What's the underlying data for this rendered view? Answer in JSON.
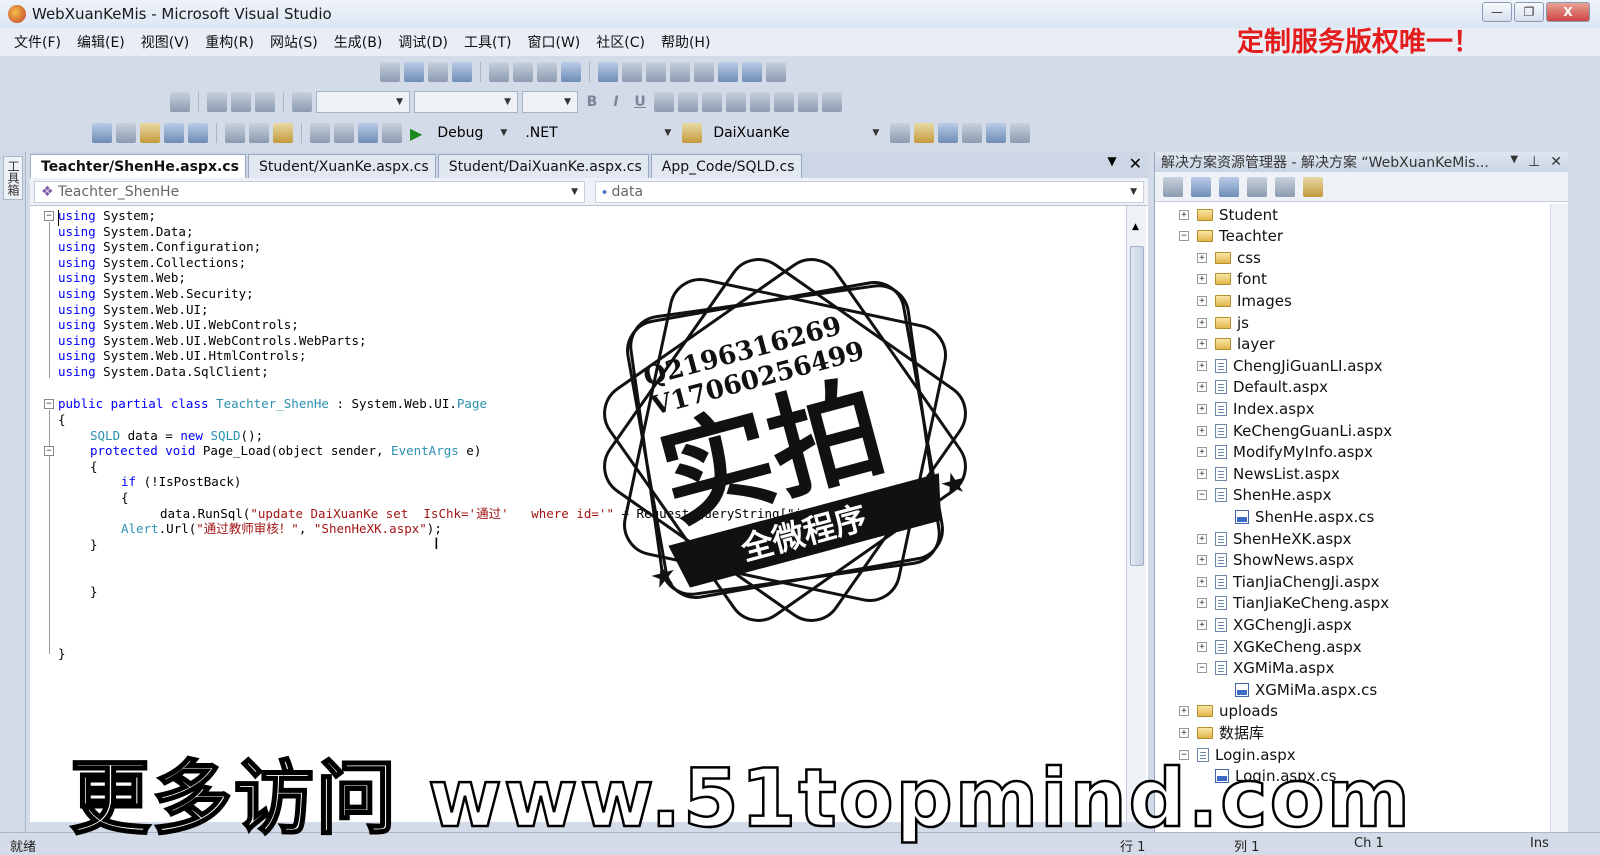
{
  "window": {
    "title": "WebXuanKeMis - Microsoft Visual Studio",
    "btn_min": "—",
    "btn_max": "❐",
    "btn_close": "X"
  },
  "promo_banner": "定制服务版权唯一！",
  "menu": [
    "文件(F)",
    "编辑(E)",
    "视图(V)",
    "重构(R)",
    "网站(S)",
    "生成(B)",
    "调试(D)",
    "工具(T)",
    "窗口(W)",
    "社区(C)",
    "帮助(H)"
  ],
  "toolbar": {
    "config": "Debug",
    "platform": ".NET",
    "find_target": "DaiXuanKe",
    "fmt_bold": "B",
    "fmt_italic": "I",
    "fmt_underline": "U"
  },
  "toolbox_label": "工具箱",
  "tabs": [
    {
      "label": "Teachter/ShenHe.aspx.cs",
      "active": true
    },
    {
      "label": "Student/XuanKe.aspx.cs",
      "active": false
    },
    {
      "label": "Student/DaiXuanKe.aspx.cs",
      "active": false
    },
    {
      "label": "App_Code/SQLD.cs",
      "active": false
    }
  ],
  "navbar": {
    "type_combo": "Teachter_ShenHe",
    "member_combo": "data"
  },
  "code": {
    "using_lines": [
      "using System;",
      "using System.Data;",
      "using System.Configuration;",
      "using System.Collections;",
      "using System.Web;",
      "using System.Web.Security;",
      "using System.Web.UI;",
      "using System.Web.UI.WebControls;",
      "using System.Web.UI.WebControls.WebParts;",
      "using System.Web.UI.HtmlControls;",
      "using System.Data.SqlClient;"
    ],
    "class_decl_kw": "public partial class ",
    "class_name": "Teachter_ShenHe",
    "class_colon": " : System.Web.UI.",
    "class_base": "Page",
    "open_brace": "{",
    "field_type": "SQLD",
    "field_mid": " data = ",
    "field_new": "new ",
    "field_type2": "SQLD",
    "field_end": "();",
    "method_kw": "protected void ",
    "method_sig": "Page_Load(object sender, ",
    "method_arg_type": "EventArgs",
    "method_end": " e)",
    "if_kw": "if ",
    "if_cond": "(!IsPostBack)",
    "runsql_pre": "data.RunSql(",
    "runsql_str": "\"update DaiXuanKe set  IsChk='通过'   where id='\"",
    "runsql_post": " + Request.QueryString[\"id\"].ToString());",
    "alert_cls": "Alert",
    "alert_pre": ".Url(",
    "alert_str1": "\"通过教师审核！\"",
    "alert_mid": ", ",
    "alert_str2": "\"ShenHeXK.aspx\"",
    "alert_end": ");",
    "close_brace": "}"
  },
  "solution_explorer": {
    "title": "解决方案资源管理器 - 解决方案 “WebXuanKeMis...",
    "items": [
      {
        "label": "Student",
        "type": "folder",
        "level": 0,
        "expander": "+"
      },
      {
        "label": "Teachter",
        "type": "folder",
        "level": 0,
        "expander": "−"
      },
      {
        "label": "css",
        "type": "folder",
        "level": 1,
        "expander": "+"
      },
      {
        "label": "font",
        "type": "folder",
        "level": 1,
        "expander": "+"
      },
      {
        "label": "Images",
        "type": "folder",
        "level": 1,
        "expander": "+"
      },
      {
        "label": "js",
        "type": "folder",
        "level": 1,
        "expander": "+"
      },
      {
        "label": "layer",
        "type": "folder",
        "level": 1,
        "expander": "+"
      },
      {
        "label": "ChengJiGuanLI.aspx",
        "type": "file",
        "level": 1,
        "expander": "+"
      },
      {
        "label": "Default.aspx",
        "type": "file",
        "level": 1,
        "expander": "+"
      },
      {
        "label": "Index.aspx",
        "type": "file",
        "level": 1,
        "expander": "+"
      },
      {
        "label": "KeChengGuanLi.aspx",
        "type": "file",
        "level": 1,
        "expander": "+"
      },
      {
        "label": "ModifyMyInfo.aspx",
        "type": "file",
        "level": 1,
        "expander": "+"
      },
      {
        "label": "NewsList.aspx",
        "type": "file",
        "level": 1,
        "expander": "+"
      },
      {
        "label": "ShenHe.aspx",
        "type": "file",
        "level": 1,
        "expander": "−"
      },
      {
        "label": "ShenHe.aspx.cs",
        "type": "cs",
        "level": 2,
        "expander": ""
      },
      {
        "label": "ShenHeXK.aspx",
        "type": "file",
        "level": 1,
        "expander": "+"
      },
      {
        "label": "ShowNews.aspx",
        "type": "file",
        "level": 1,
        "expander": "+"
      },
      {
        "label": "TianJiaChengJi.aspx",
        "type": "file",
        "level": 1,
        "expander": "+"
      },
      {
        "label": "TianJiaKeCheng.aspx",
        "type": "file",
        "level": 1,
        "expander": "+"
      },
      {
        "label": "XGChengJi.aspx",
        "type": "file",
        "level": 1,
        "expander": "+"
      },
      {
        "label": "XGKeCheng.aspx",
        "type": "file",
        "level": 1,
        "expander": "+"
      },
      {
        "label": "XGMiMa.aspx",
        "type": "file",
        "level": 1,
        "expander": "−"
      },
      {
        "label": "XGMiMa.aspx.cs",
        "type": "cs",
        "level": 2,
        "expander": ""
      },
      {
        "label": "uploads",
        "type": "folder",
        "level": 0,
        "expander": "+"
      },
      {
        "label": "数据库",
        "type": "folder",
        "level": 0,
        "expander": "+"
      },
      {
        "label": "Login.aspx",
        "type": "file",
        "level": 0,
        "expander": "−"
      },
      {
        "label": "Login.aspx.cs",
        "type": "cs",
        "level": 1,
        "expander": ""
      }
    ]
  },
  "status": {
    "left": "就绪",
    "line": "行 1",
    "col": "列 1",
    "ch": "Ch 1",
    "mode": "Ins"
  },
  "stamp": {
    "line1": "Q2196316269",
    "line2": "V17060256499",
    "big": "实拍",
    "ribbon": "全微程序"
  },
  "watermark": {
    "cn": "更多访问",
    "url": "www.51topmind.com"
  }
}
